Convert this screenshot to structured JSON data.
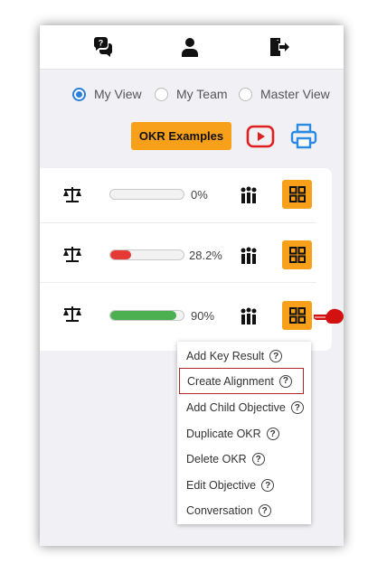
{
  "topbar": {
    "icons": [
      "chat-help-icon",
      "user-icon",
      "logout-icon"
    ]
  },
  "view_options": [
    {
      "label": "My View",
      "selected": true
    },
    {
      "label": "My Team",
      "selected": false
    },
    {
      "label": "Master View",
      "selected": false
    }
  ],
  "toolbar": {
    "okr_examples_label": "OKR Examples",
    "icons": [
      "youtube-icon",
      "printer-icon"
    ],
    "accent": "#f9a01b"
  },
  "objectives": [
    {
      "progress_label": "0%",
      "progress": 0,
      "bar_color": "#cccccc"
    },
    {
      "progress_label": "28.2%",
      "progress": 0.282,
      "bar_color": "#e53935"
    },
    {
      "progress_label": "90%",
      "progress": 0.9,
      "bar_color": "#4caf50"
    }
  ],
  "menu": {
    "items": [
      {
        "label": "Add Key Result"
      },
      {
        "label": "Create Alignment",
        "highlighted": true
      },
      {
        "label": "Add Child Objective"
      },
      {
        "label": "Duplicate OKR"
      },
      {
        "label": "Delete OKR"
      },
      {
        "label": "Edit Objective"
      },
      {
        "label": "Conversation"
      }
    ],
    "help_glyph": "?"
  }
}
